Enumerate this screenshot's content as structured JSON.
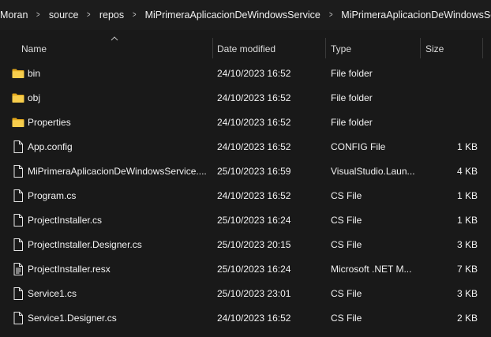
{
  "breadcrumb": [
    "Moran",
    "source",
    "repos",
    "MiPrimeraAplicacionDeWindowsService",
    "MiPrimeraAplicacionDeWindowsService"
  ],
  "columns": {
    "name": "Name",
    "date": "Date modified",
    "type": "Type",
    "size": "Size"
  },
  "sort": {
    "column": "Name",
    "direction": "ascending",
    "icon": "chevron-up-icon"
  },
  "files": [
    {
      "name": "bin",
      "date": "24/10/2023 16:52",
      "type": "File folder",
      "size": "",
      "icon": "folder-icon"
    },
    {
      "name": "obj",
      "date": "24/10/2023 16:52",
      "type": "File folder",
      "size": "",
      "icon": "folder-icon"
    },
    {
      "name": "Properties",
      "date": "24/10/2023 16:52",
      "type": "File folder",
      "size": "",
      "icon": "folder-icon"
    },
    {
      "name": "App.config",
      "date": "24/10/2023 16:52",
      "type": "CONFIG File",
      "size": "1 KB",
      "icon": "file-icon"
    },
    {
      "name": "MiPrimeraAplicacionDeWindowsService....",
      "date": "25/10/2023 16:59",
      "type": "VisualStudio.Laun...",
      "size": "4 KB",
      "icon": "file-icon"
    },
    {
      "name": "Program.cs",
      "date": "24/10/2023 16:52",
      "type": "CS File",
      "size": "1 KB",
      "icon": "file-icon"
    },
    {
      "name": "ProjectInstaller.cs",
      "date": "25/10/2023 16:24",
      "type": "CS File",
      "size": "1 KB",
      "icon": "file-icon"
    },
    {
      "name": "ProjectInstaller.Designer.cs",
      "date": "25/10/2023 20:15",
      "type": "CS File",
      "size": "3 KB",
      "icon": "file-icon"
    },
    {
      "name": "ProjectInstaller.resx",
      "date": "25/10/2023 16:24",
      "type": "Microsoft .NET M...",
      "size": "7 KB",
      "icon": "text-file-icon"
    },
    {
      "name": "Service1.cs",
      "date": "25/10/2023 23:01",
      "type": "CS File",
      "size": "3 KB",
      "icon": "file-icon"
    },
    {
      "name": "Service1.Designer.cs",
      "date": "24/10/2023 16:52",
      "type": "CS File",
      "size": "2 KB",
      "icon": "file-icon"
    }
  ],
  "colors": {
    "background": "#191919",
    "folder": "#f4c542",
    "text": "#f2f2f2"
  }
}
